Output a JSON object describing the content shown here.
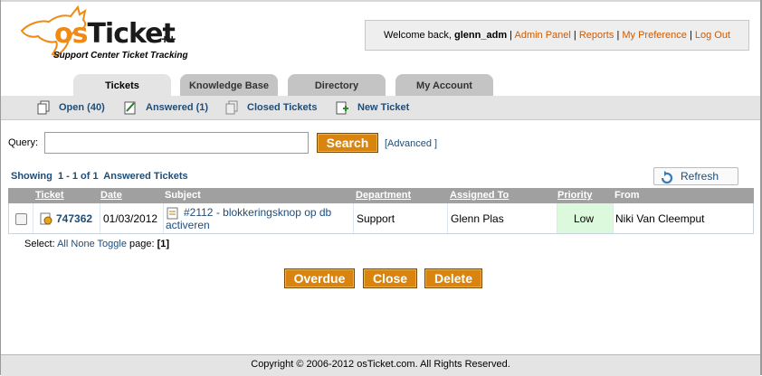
{
  "header": {
    "logo_text_os": "os",
    "logo_text_ticket": "Ticket",
    "logo_plus": "++",
    "logo_tagline": "Support Center Ticket Tracking",
    "welcome_prefix": "Welcome back, ",
    "username": "glenn_adm",
    "links": [
      "Admin Panel",
      "Reports",
      "My Preference",
      "Log Out"
    ]
  },
  "tabs": [
    "Tickets",
    "Knowledge Base",
    "Directory",
    "My Account"
  ],
  "active_tab": "Tickets",
  "subnav": [
    {
      "label": "Open (40)",
      "icon": "open-tickets-icon"
    },
    {
      "label": "Answered (1)",
      "icon": "answered-tickets-icon"
    },
    {
      "label": "Closed Tickets",
      "icon": "closed-tickets-icon"
    },
    {
      "label": "New Ticket",
      "icon": "new-ticket-icon"
    }
  ],
  "search": {
    "label": "Query:",
    "value": "",
    "button": "Search",
    "advanced": "[Advanced ]"
  },
  "listing": {
    "showing_label": "Showing",
    "range": "1 - 1 of 1",
    "title": "Answered Tickets",
    "refresh_label": "Refresh"
  },
  "table": {
    "columns": [
      "Ticket",
      "Date",
      "Subject",
      "Department",
      "Assigned To",
      "Priority",
      "From"
    ],
    "rows": [
      {
        "ticket": "747362",
        "date": "01/03/2012",
        "subject_line1": "#2112 - blokkeringsknop op db",
        "subject_line2": "activeren",
        "department": "Support",
        "assigned_to": "Glenn Plas",
        "priority": "Low",
        "from": "Niki Van Cleemput"
      }
    ]
  },
  "selection": {
    "label": "Select:",
    "all": "All",
    "none": "None",
    "toggle": "Toggle",
    "page_label": "page:",
    "page_value": "[1]"
  },
  "actions": [
    "Overdue",
    "Close",
    "Delete"
  ],
  "footer": "Copyright © 2006-2012 osTicket.com.  All Rights Reserved.",
  "colors": {
    "accent": "#d9840e",
    "link": "#1e4d7a",
    "admin_link": "#d05a00",
    "priority_low_bg": "#ddf9dd"
  }
}
